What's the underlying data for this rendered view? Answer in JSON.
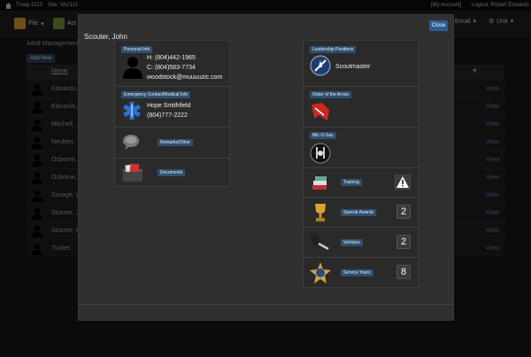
{
  "topbar": {
    "troop": "Troop 2112",
    "site": "Site: VA2112",
    "account": "[My Account]",
    "logout": "Logout: Robert Edwards"
  },
  "nav": {
    "file": "File",
    "act": "Act",
    "email": "Email",
    "unit": "Unit"
  },
  "background": {
    "title": "Adult Management",
    "add_new": "Add New",
    "name_header": "Name",
    "view_label": "View",
    "rows": [
      "Edwards,",
      "Edwards,",
      "Mitchell,",
      "Neuben,",
      "Osborne,",
      "Osborne,",
      "Savage, W",
      "Scouter, J",
      "Scouter, N",
      "Tucker,"
    ]
  },
  "modal": {
    "title": "Scouter, John",
    "close": "Close",
    "personal": {
      "label": "Personal Info",
      "home": "H: (804)442-1965",
      "cell": "C: (804)583-7734",
      "email": "woodstock@muuuuzic.com"
    },
    "emergency": {
      "label": "Emergency Contact/Medical Info",
      "name": "Hope Smithfield",
      "phone": "(804)777-2222"
    },
    "remarks": {
      "label": "Remarks/Other"
    },
    "documents": {
      "label": "Documents"
    },
    "leadership": {
      "label": "Leadership Positions",
      "position": "Scoutmaster"
    },
    "oa": {
      "label": "Order of the Arrow"
    },
    "mos": {
      "label": "Mic-O-Say"
    },
    "training": {
      "label": "Training"
    },
    "awards": {
      "label": "Special Awards",
      "count": "2"
    },
    "vehicles": {
      "label": "Vehicles",
      "count": "2"
    },
    "service": {
      "label": "Service Years",
      "count": "8"
    }
  },
  "colors": {
    "label_bg": "#2e5070",
    "close_bg": "#2e5c92",
    "view_link": "#4d7fb5"
  }
}
